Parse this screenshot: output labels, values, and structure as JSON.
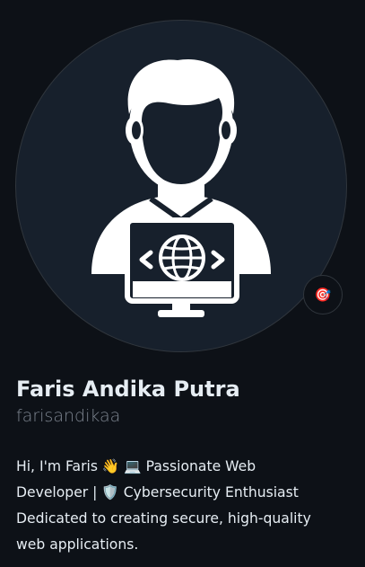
{
  "profile": {
    "full_name": "Faris Andika Putra",
    "username": "farisandikaa",
    "status_emoji": "🎯",
    "avatar_icon": "developer-with-globe-monitor-icon",
    "bio_lines": [
      "Hi, I'm Faris 👋 💻 Passionate Web",
      "Developer | 🛡️ Cybersecurity Enthusiast",
      "Dedicated to creating secure, high-quality",
      "web applications."
    ]
  },
  "colors": {
    "background": "#0d1117",
    "avatar_background": "#17202c",
    "text_primary": "#e6edf3",
    "text_muted": "#7d8590",
    "border": "#30363d"
  }
}
